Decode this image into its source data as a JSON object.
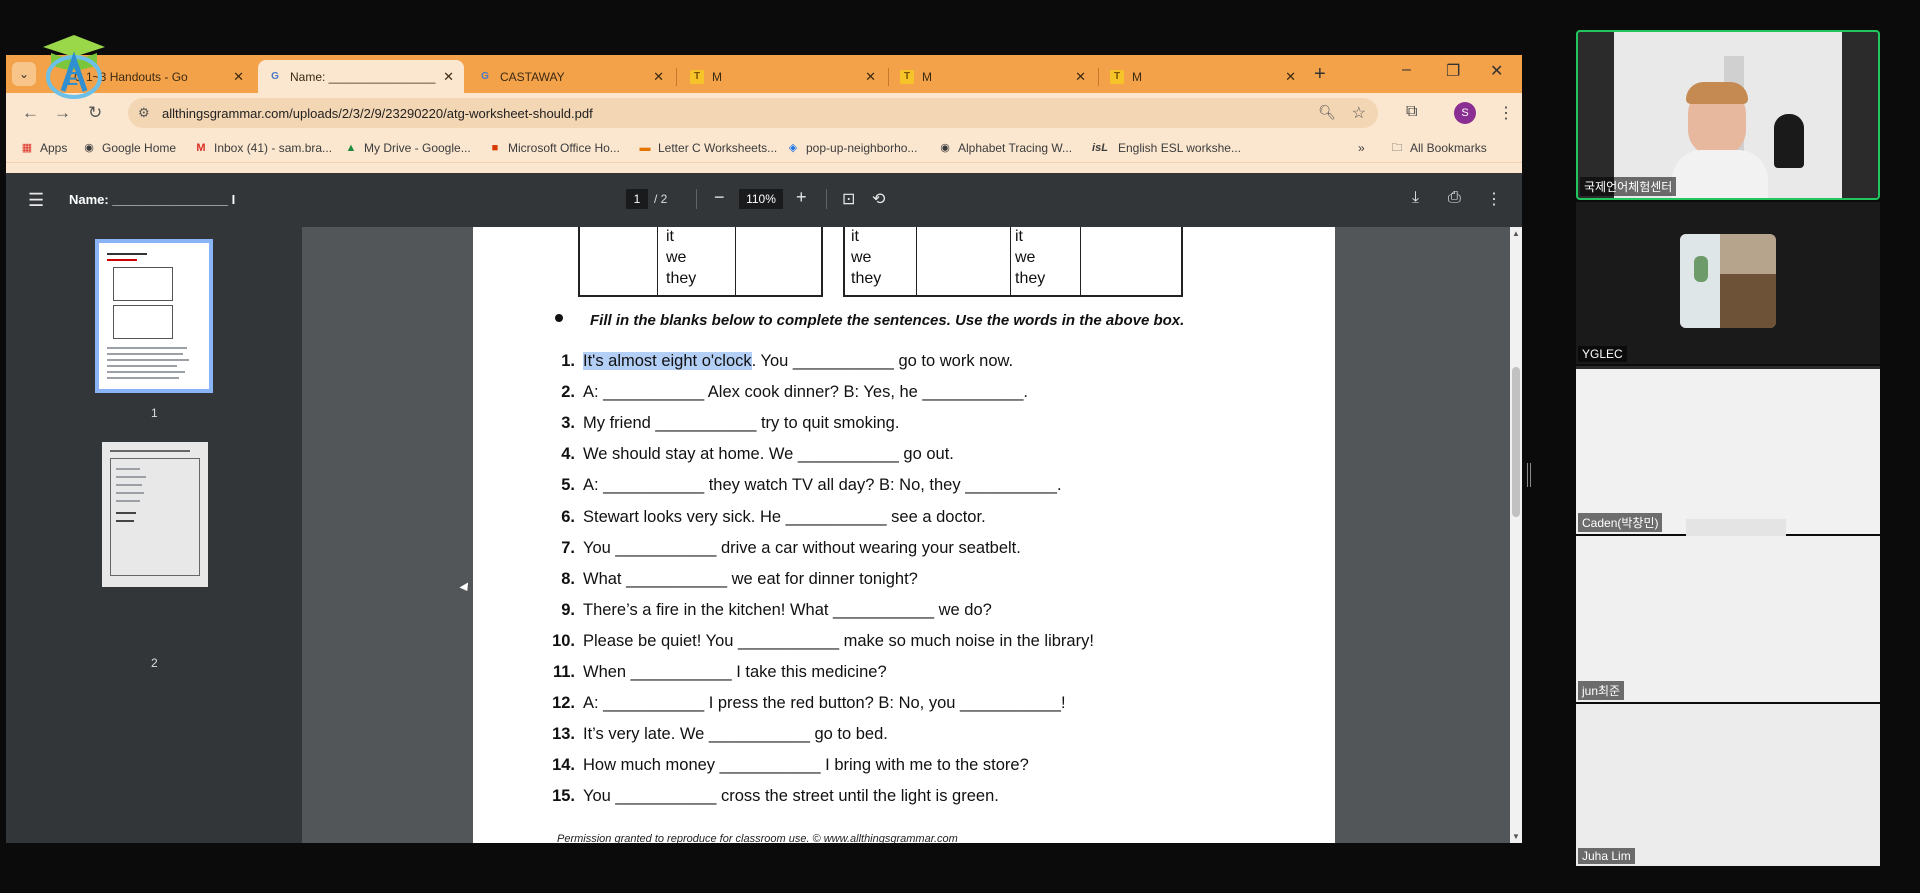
{
  "browser": {
    "tabs": [
      {
        "title": "C 1~3 Handouts - Go",
        "icon": "google-docs",
        "active": false
      },
      {
        "title": "Name: ________________",
        "icon": "google",
        "active": true
      },
      {
        "title": "CASTAWAY",
        "icon": "google",
        "active": false
      },
      {
        "title": "M",
        "icon": "t-icon",
        "active": false
      },
      {
        "title": "M",
        "icon": "t-icon",
        "active": false
      },
      {
        "title": "M",
        "icon": "t-icon",
        "active": false
      }
    ],
    "url": "allthingsgrammar.com/uploads/2/3/2/9/23290220/atg-worksheet-should.pdf",
    "profile_initial": "S",
    "bookmarks": [
      {
        "label": "Apps",
        "icon": "apps-grid-icon"
      },
      {
        "label": "Google Home",
        "icon": "globe-icon"
      },
      {
        "label": "Inbox (41) - sam.bra...",
        "icon": "gmail-icon"
      },
      {
        "label": "My Drive - Google...",
        "icon": "drive-icon"
      },
      {
        "label": "Microsoft Office Ho...",
        "icon": "office-icon"
      },
      {
        "label": "Letter C Worksheets...",
        "icon": "bookmark-icon"
      },
      {
        "label": "pop-up-neighborho...",
        "icon": "tag-icon"
      },
      {
        "label": "Alphabet Tracing W...",
        "icon": "globe-icon"
      },
      {
        "label": "English ESL workshe...",
        "icon": "isl-icon",
        "prefix": "isL"
      }
    ],
    "all_bookmarks": "All Bookmarks",
    "colors": {
      "tabstrip": "#f4a24a",
      "toolbar": "#fbe7cf",
      "pdf_toolbar": "#323639"
    }
  },
  "pdf": {
    "title": "Name: ________________ I",
    "page_current": "1",
    "page_total": "/ 2",
    "zoom": "110%",
    "thumbnails": [
      {
        "label": "1",
        "selected": true
      },
      {
        "label": "2",
        "selected": false
      }
    ],
    "pronouns": [
      "it",
      "we",
      "they"
    ],
    "instruction": "Fill in the blanks below to complete the sentences.  Use the words in the above box.",
    "items": [
      {
        "n": "1.",
        "hl": "It's almost eight o'clock",
        "text": ".  You ___________ go to work now."
      },
      {
        "n": "2.",
        "text": "A: ___________ Alex cook dinner?    B: Yes, he ___________."
      },
      {
        "n": "3.",
        "text": "My friend ___________ try to quit smoking."
      },
      {
        "n": "4.",
        "text": "We should stay at home.  We ___________ go out."
      },
      {
        "n": "5.",
        "text": "A: ___________ they watch TV all day?    B: No, they __________."
      },
      {
        "n": "6.",
        "text": "Stewart looks very sick.  He ___________ see a doctor."
      },
      {
        "n": "7.",
        "text": "You ___________ drive a car without wearing your seatbelt."
      },
      {
        "n": "8.",
        "text": "What ___________ we eat for dinner tonight?"
      },
      {
        "n": "9.",
        "text": "There’s a fire in the kitchen!  What ___________ we do?"
      },
      {
        "n": "10.",
        "text": "Please be quiet!  You ___________ make so much noise in the library!"
      },
      {
        "n": "11.",
        "text": "When ___________ I take this medicine?"
      },
      {
        "n": "12.",
        "text": "A: ___________ I press the red button?    B: No, you ___________!"
      },
      {
        "n": "13.",
        "text": "It’s very late.  We ___________ go to bed."
      },
      {
        "n": "14.",
        "text": "How much money ___________ I bring with me to the store?"
      },
      {
        "n": "15.",
        "text": "You ___________ cross the street until the light is green."
      }
    ],
    "footer": "Permission granted to reproduce for classroom use.   © www.allthingsgrammar.com"
  },
  "participants": [
    {
      "name": "국제언어체험센터",
      "active_speaker": true
    },
    {
      "name": "YGLEC"
    },
    {
      "name": "Caden(박창민)"
    },
    {
      "name": "jun최준"
    },
    {
      "name": "Juha Lim"
    }
  ]
}
